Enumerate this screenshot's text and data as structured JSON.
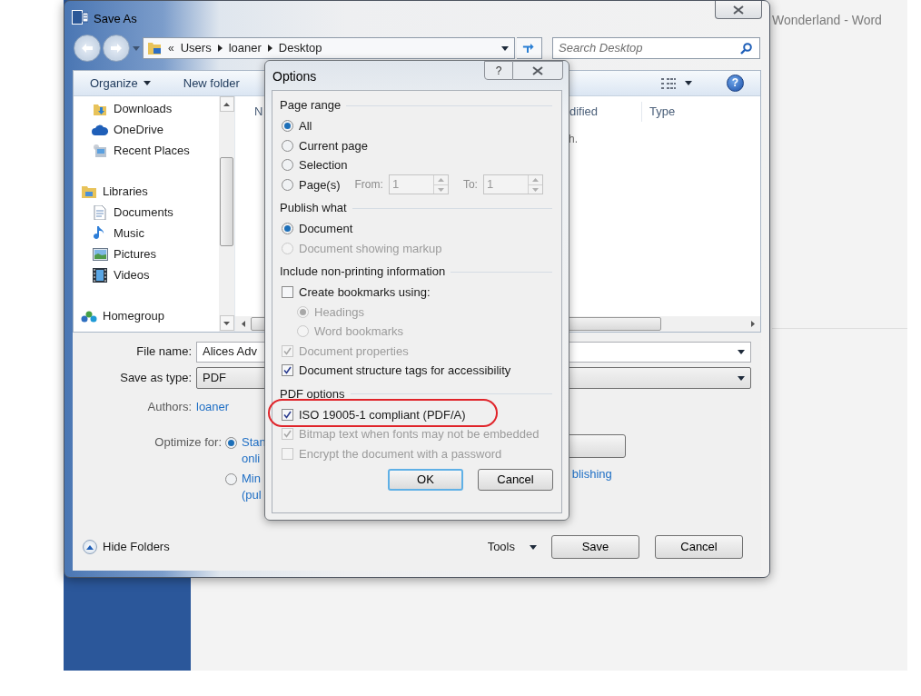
{
  "word_window": {
    "title": "Wonderland - Word"
  },
  "save_as": {
    "title": "Save As",
    "address": {
      "overflow": "«",
      "crumbs": [
        "Users",
        "loaner",
        "Desktop"
      ]
    },
    "search": {
      "placeholder": "Search Desktop"
    },
    "toolbar": [
      {
        "label": "Organize",
        "menu": true
      },
      {
        "label": "New folder",
        "menu": false
      }
    ],
    "sidebar": {
      "groups": [
        {
          "items": [
            {
              "label": "Downloads",
              "kind": "downloads"
            },
            {
              "label": "OneDrive",
              "kind": "cloud"
            },
            {
              "label": "Recent Places",
              "kind": "recent"
            }
          ]
        },
        {
          "items": [
            {
              "label": "Libraries",
              "kind": "library",
              "children": [
                {
                  "label": "Documents",
                  "kind": "document"
                },
                {
                  "label": "Music",
                  "kind": "music"
                },
                {
                  "label": "Pictures",
                  "kind": "pictures"
                },
                {
                  "label": "Videos",
                  "kind": "video"
                }
              ]
            }
          ]
        },
        {
          "items": [
            {
              "label": "Homegroup",
              "kind": "homegroup"
            }
          ]
        }
      ]
    },
    "columns": [
      "N",
      "dified",
      "Type"
    ],
    "file_list_text": "h.",
    "file_name_label": "File name:",
    "file_name": "Alices Adv",
    "type_label": "Save as type:",
    "type": "PDF",
    "authors_label": "Authors:",
    "authors": "loaner",
    "optimize_label": "Optimize for:",
    "optimize_options": [
      {
        "lines": [
          "Stan",
          "onli"
        ],
        "selected": true
      },
      {
        "lines": [
          "Min",
          "(pul"
        ],
        "selected": false
      }
    ],
    "publishing_link": "blishing",
    "hide_folders": "Hide Folders",
    "tools": "Tools",
    "buttons": [
      {
        "label": "Save"
      },
      {
        "label": "Cancel"
      }
    ]
  },
  "options": {
    "title": "Options",
    "help": "?",
    "sections": [
      {
        "title": "Page range",
        "items": [
          {
            "label": "All",
            "kind": "radio",
            "selected": true,
            "disabled": false
          },
          {
            "label": "Current page",
            "kind": "radio",
            "selected": false,
            "disabled": false
          },
          {
            "label": "Selection",
            "kind": "radio",
            "selected": false,
            "disabled": false
          },
          {
            "label": "Page(s)",
            "kind": "radio",
            "selected": false,
            "disabled": false,
            "range": {
              "from_label": "From:",
              "from": "1",
              "to_label": "To:",
              "to": "1",
              "disabled": true
            }
          }
        ]
      },
      {
        "title": "Publish what",
        "items": [
          {
            "label": "Document",
            "kind": "radio",
            "selected": true,
            "disabled": false
          },
          {
            "label": "Document showing markup",
            "kind": "radio",
            "selected": false,
            "disabled": true
          }
        ]
      },
      {
        "title": "Include non-printing information",
        "items": [
          {
            "label": "Create bookmarks using:",
            "kind": "checkbox",
            "checked": false,
            "disabled": false,
            "children": [
              {
                "label": "Headings",
                "kind": "radio",
                "selected": true,
                "disabled": true
              },
              {
                "label": "Word bookmarks",
                "kind": "radio",
                "selected": false,
                "disabled": true
              }
            ]
          },
          {
            "label": "Document properties",
            "kind": "checkbox",
            "checked": true,
            "disabled": true
          },
          {
            "label": "Document structure tags for accessibility",
            "kind": "checkbox",
            "checked": true,
            "disabled": false
          }
        ]
      },
      {
        "title": "PDF options",
        "items": [
          {
            "label": "ISO 19005-1 compliant (PDF/A)",
            "kind": "checkbox",
            "checked": true,
            "disabled": false,
            "highlighted": true
          },
          {
            "label": "Bitmap text when fonts may not be embedded",
            "kind": "checkbox",
            "checked": true,
            "disabled": true
          },
          {
            "label": "Encrypt the document with a password",
            "kind": "checkbox",
            "checked": false,
            "disabled": true
          }
        ]
      }
    ],
    "buttons": [
      {
        "label": "OK",
        "default": true
      },
      {
        "label": "Cancel",
        "default": false
      }
    ]
  }
}
